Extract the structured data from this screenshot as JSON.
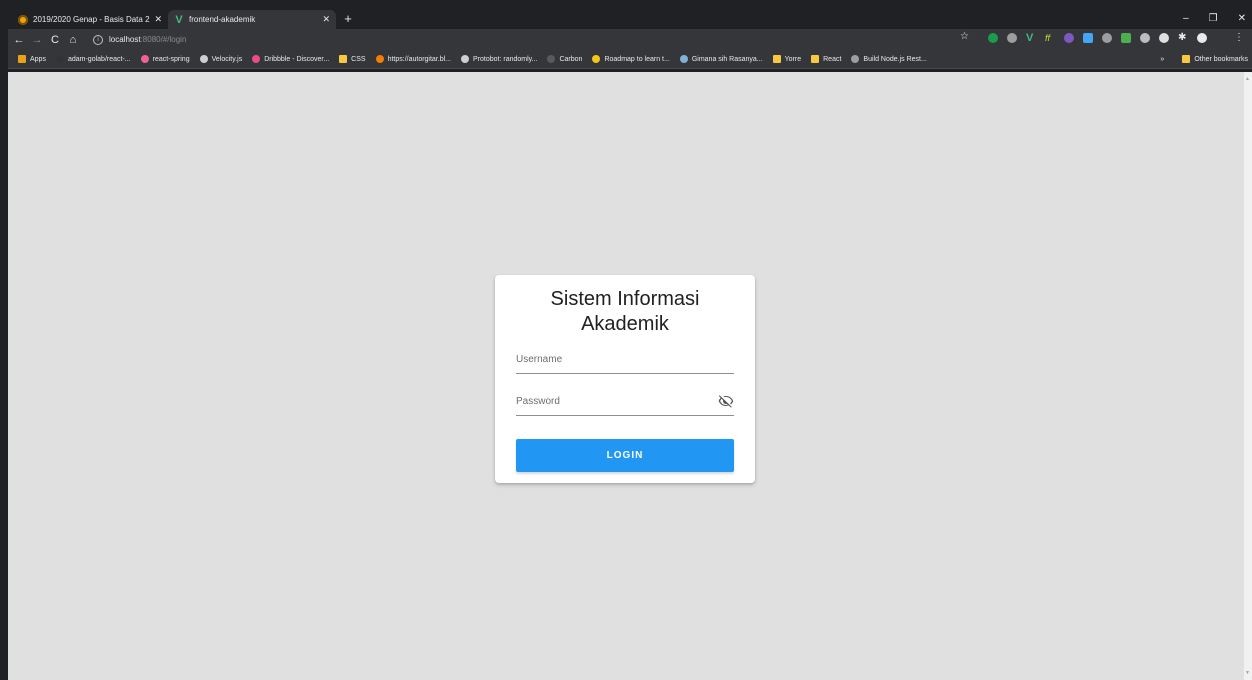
{
  "browser": {
    "tabs": [
      {
        "title": "2019/2020 Genap - Basis Data 2",
        "favicon": "moodle-icon"
      },
      {
        "title": "frontend-akademik",
        "favicon": "vue-icon"
      }
    ],
    "tab_close_glyph": "✕",
    "new_tab_glyph": "+",
    "window_controls": [
      "–",
      "❐",
      "✕"
    ],
    "address": {
      "host": "localhost",
      "path": ":8080/#/login"
    },
    "bookmarks": [
      {
        "label": "Apps",
        "icon": "apps-grid-icon",
        "color": "#e8a317"
      },
      {
        "label": "adam-golab/react-...",
        "icon": "github-icon",
        "color": "#333333"
      },
      {
        "label": "react-spring",
        "icon": "react-spring-icon",
        "color": "#f06292"
      },
      {
        "label": "Velocity.js",
        "icon": "globe-icon",
        "color": "#cfcfcf"
      },
      {
        "label": "Dribbble - Discover...",
        "icon": "dribbble-icon",
        "color": "#ea4c89"
      },
      {
        "label": "CSS",
        "icon": "folder-icon",
        "color": "#f6c644"
      },
      {
        "label": "https://autorgitar.bl...",
        "icon": "blogger-icon",
        "color": "#f57d00"
      },
      {
        "label": "Protobot: randomly...",
        "icon": "globe-icon",
        "color": "#cfcfcf"
      },
      {
        "label": "Carbon",
        "icon": "carbon-icon",
        "color": "#5a5a5a"
      },
      {
        "label": "Roadmap to learn t...",
        "icon": "roadmap-icon",
        "color": "#f5c518"
      },
      {
        "label": "Gimana sih Rasanya...",
        "icon": "article-icon",
        "color": "#7fb3d5"
      },
      {
        "label": "Yorre",
        "icon": "folder-icon",
        "color": "#f6c644"
      },
      {
        "label": "React",
        "icon": "folder-icon",
        "color": "#f6c644"
      },
      {
        "label": "Build Node.js Rest...",
        "icon": "braces-icon",
        "color": "#9e9e9e"
      }
    ],
    "overflow_label": "»",
    "other_bookmarks_label": "Other bookmarks"
  },
  "login": {
    "title": "Sistem Informasi Akademik",
    "username_placeholder": "Username",
    "password_placeholder": "Password",
    "button_label": "LOGIN",
    "accent_color": "#2196f3"
  }
}
